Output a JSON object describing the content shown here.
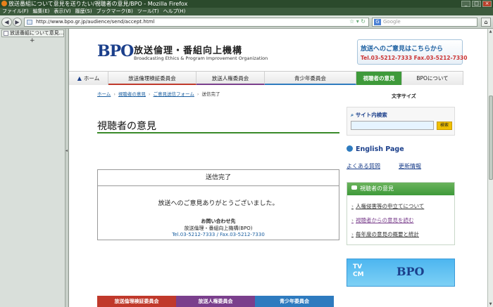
{
  "window": {
    "title": "放送番組について意見を送りたい/視聴者の意見/BPO - Mozilla Firefox"
  },
  "menu": [
    "ファイル(F)",
    "編集(E)",
    "表示(V)",
    "履歴(S)",
    "ブックマーク(B)",
    "ツール(T)",
    "ヘルプ(H)"
  ],
  "toolbar": {
    "url": "http://www.bpo.gr.jp/audience/send/accept.html",
    "search_placeholder": "Google",
    "new_tab": "+"
  },
  "sidebar": {
    "tab_label": "放送番組について意見..."
  },
  "site": {
    "logo": "BPO",
    "name_ja": "放送倫理・番組向上機構",
    "name_en": "Broadcasting Ethics & Program Improvement Organization",
    "opinion_banner_title": "放送へのご意見はこちらから",
    "opinion_banner_phone": "Tel.03-5212-7333 Fax.03-5212-7330"
  },
  "nav": [
    "ホーム",
    "放送倫理検証委員会",
    "放送人権委員会",
    "青少年委員会",
    "視聴者の意見",
    "BPOについて"
  ],
  "breadcrumb": [
    "ホーム",
    "視聴者の意見",
    "ご意見送信フォーム",
    "送信完了"
  ],
  "page": {
    "title": "視聴者の意見"
  },
  "notice": {
    "heading": "送信完了",
    "message": "放送へのご意見ありがとうございました。",
    "contact_label": "お問い合わせ先",
    "contact_org": "放送倫理・番組向上機構(BPO)",
    "contact_phone": "Tel.03-5212-7333 / Fax.03-5212-7330"
  },
  "footer_nav": [
    "放送倫理検証委員会",
    "放送人権委員会",
    "青少年委員会"
  ],
  "side": {
    "font_size_label": "文字サイズ",
    "search_label": "サイト内検索",
    "search_button": "検索",
    "english": "English Page",
    "faq": "よくある質問",
    "updates": "更新情報",
    "viewer_heading": "視聴者の意見",
    "viewer_links": [
      "人権侵害等の申立てについて",
      "視聴者からの意見を読む",
      "毎年度の意見の概要と統計"
    ],
    "tv_line1": "TV",
    "tv_line2": "CM",
    "tv_logo": "BPO"
  }
}
